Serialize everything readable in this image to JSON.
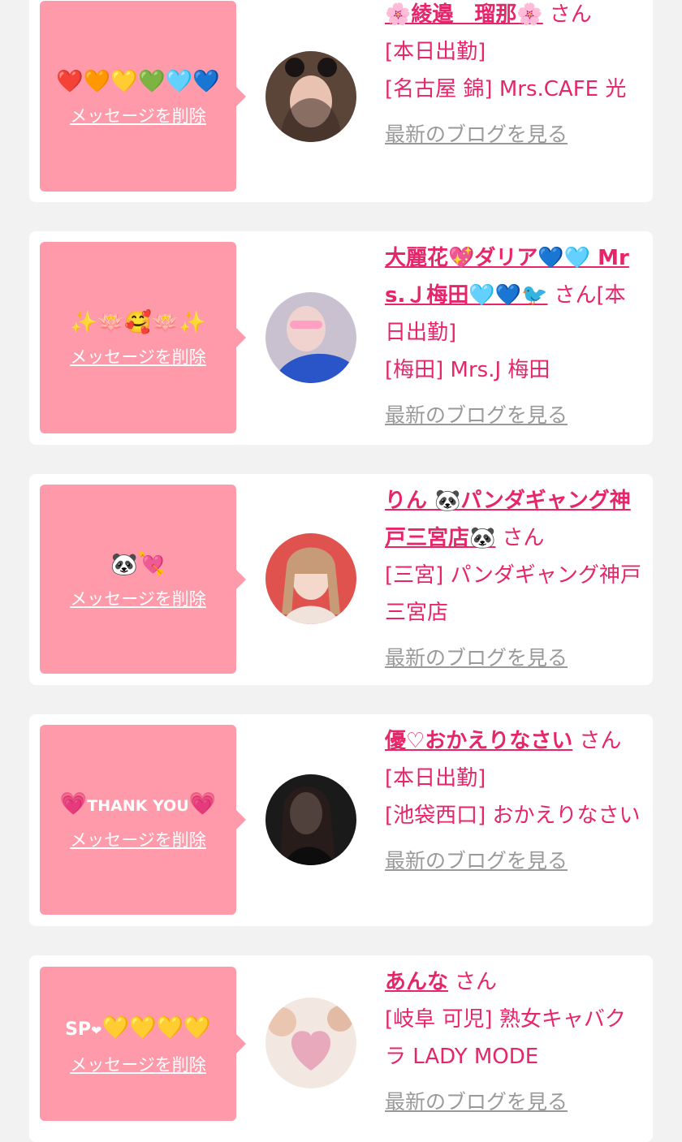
{
  "delete_label": "メッセージを削除",
  "san_label": "さん",
  "blog_label": "最新のブログを見る",
  "accent_color": "#e6256a",
  "bubble_color": "#fe9aaa",
  "cards": [
    {
      "message": "❤️🧡💛💚🩵💙",
      "name": "🌸綾邉　瑠那🌸",
      "status": "[本日出勤]",
      "shop": "[名古屋 錦] Mrs.CAFE 光"
    },
    {
      "message": "✨🪷🥰🪷✨",
      "name": "大麗花💖ダリア💙🩵 Mrs.Ｊ梅田🩵💙🐦",
      "status": "[本日出勤]",
      "shop": "[梅田] Mrs.J 梅田"
    },
    {
      "message": "🐼💘",
      "name": "りん 🐼パンダギャング神戸三宮店🐼",
      "status": "",
      "shop": "[三宮] パンダギャング神戸三宮店"
    },
    {
      "message_parts": [
        "💗",
        "THANK YOU",
        "💗"
      ],
      "name": "優♡おかえりなさい",
      "status": "[本日出勤]",
      "shop": "[池袋西口] おかえりなさい"
    },
    {
      "message_parts": [
        "SP",
        "❤",
        "💛💛💛💛"
      ],
      "name": "あんな",
      "status": "",
      "shop": "[岐阜 可児] 熟女キャバクラ LADY MODE"
    }
  ]
}
